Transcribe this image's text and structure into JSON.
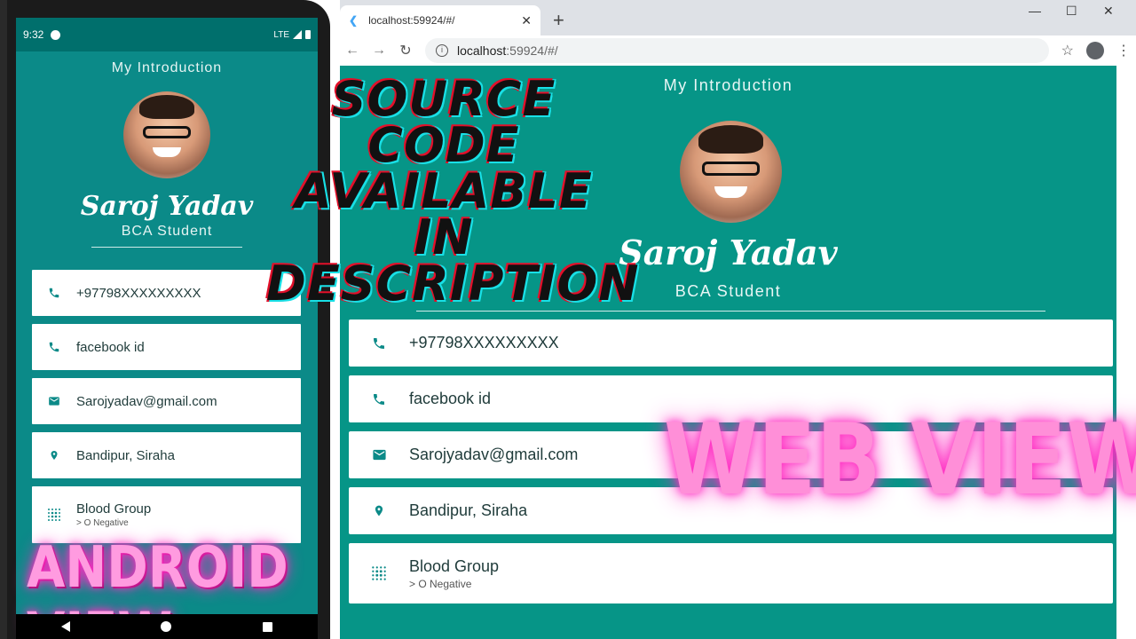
{
  "android": {
    "status": {
      "time": "9:32",
      "network": "LTE"
    },
    "title": "My Introduction",
    "name": "Saroj Yadav",
    "subtitle": "BCA Student",
    "cards": [
      {
        "icon": "phone-icon",
        "text": "+97798XXXXXXXXX"
      },
      {
        "icon": "phone-icon",
        "text": "facebook id"
      },
      {
        "icon": "email-icon",
        "text": "Sarojyadav@gmail.com"
      },
      {
        "icon": "location-icon",
        "text": "Bandipur, Siraha"
      },
      {
        "icon": "blood-icon",
        "text": "Blood Group",
        "sub": "> O Negative"
      }
    ],
    "label": "ANDROID VIEW"
  },
  "browser": {
    "tab_title": "localhost:59924/#/",
    "url_host": "localhost",
    "url_rest": ":59924/#/",
    "title": "My Introduction",
    "name": "Saroj Yadav",
    "subtitle": "BCA Student",
    "cards": [
      {
        "icon": "phone-icon",
        "text": "+97798XXXXXXXXX"
      },
      {
        "icon": "phone-icon",
        "text": "facebook id"
      },
      {
        "icon": "email-icon",
        "text": "Sarojyadav@gmail.com"
      },
      {
        "icon": "location-icon",
        "text": "Bandipur, Siraha"
      },
      {
        "icon": "blood-icon",
        "text": "Blood Group",
        "sub": "> O Negative"
      }
    ],
    "label": "WEB VIEW"
  },
  "headline": [
    "SOURCE CODE",
    "AVAILABLE",
    "IN",
    "DESCRIPTION"
  ],
  "colors": {
    "teal": "#069587",
    "teal_dark": "#006f6c",
    "neon_pink": "#ff8fd8"
  }
}
